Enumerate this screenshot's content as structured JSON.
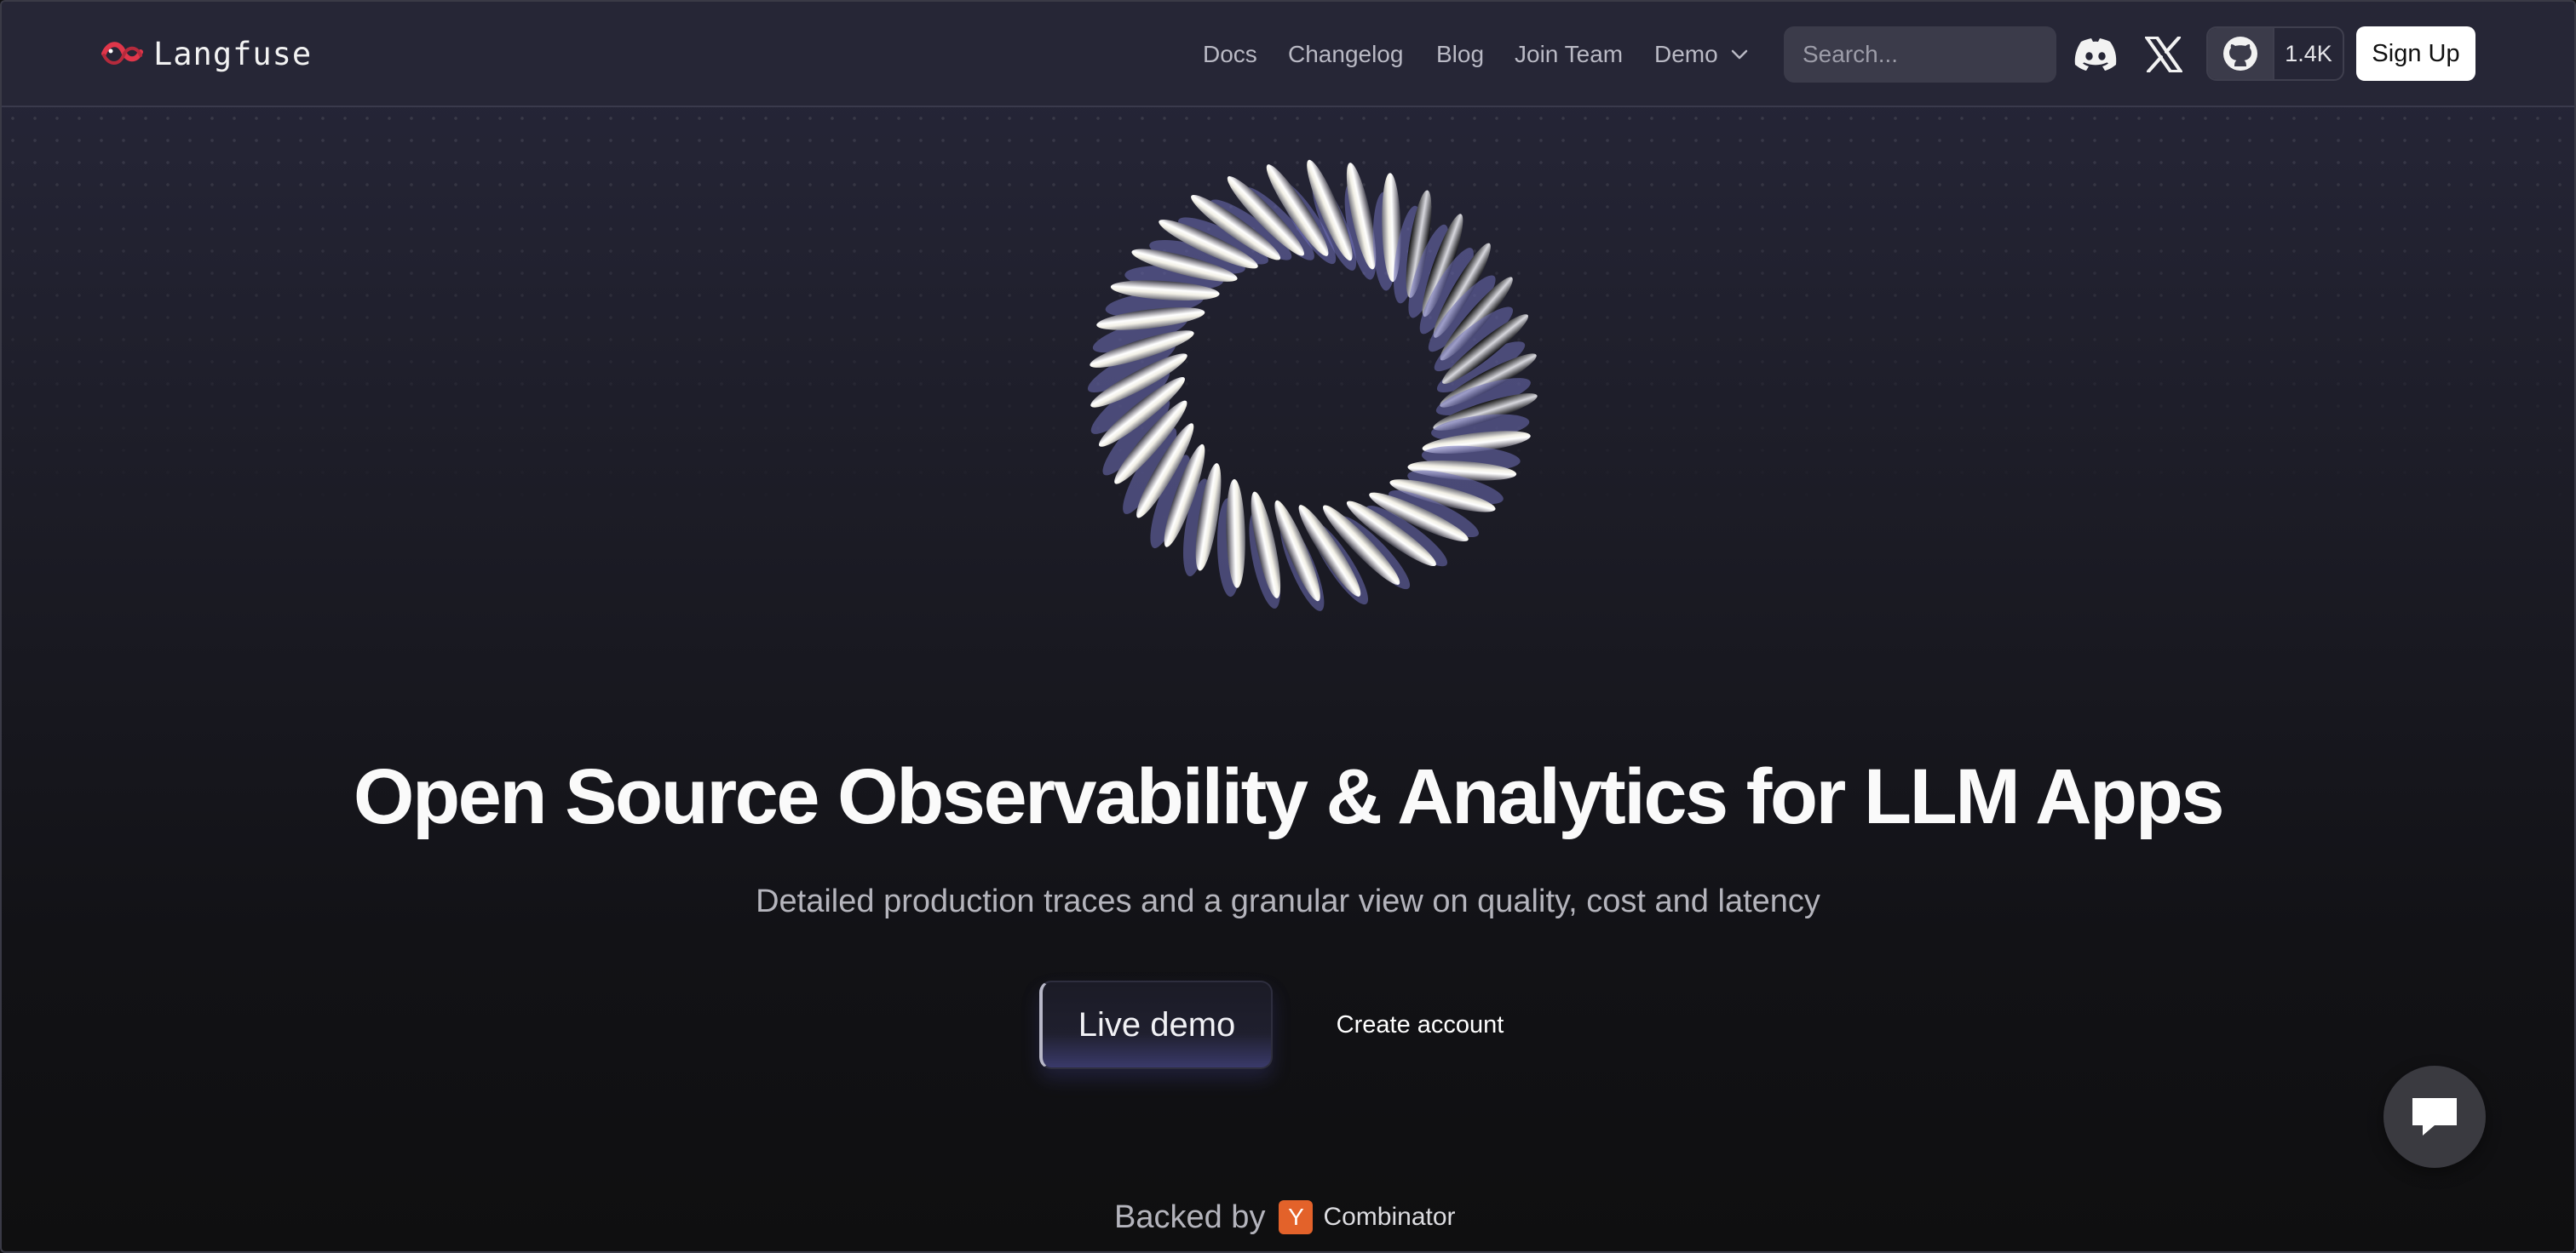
{
  "brand": {
    "name": "Langfuse",
    "accent": "#e0364a"
  },
  "nav": {
    "links": [
      "Docs",
      "Changelog",
      "Blog",
      "Join Team"
    ],
    "demo_label": "Demo",
    "search_placeholder": "Search...",
    "github_stars": "1.4K",
    "signup_label": "Sign Up",
    "icons": [
      "discord-icon",
      "x-icon",
      "github-icon",
      "chevron-down-icon"
    ]
  },
  "hero": {
    "headline": "Open Source Observability & Analytics for LLM Apps",
    "subheadline": "Detailed production traces and a granular view on quality, cost and latency",
    "primary_cta": "Live demo",
    "secondary_cta": "Create account"
  },
  "backed": {
    "label": "Backed by",
    "yc_letter": "Y",
    "yc_name": "Combinator",
    "yc_color": "#e3622a"
  },
  "chat": {
    "icon": "chat-bubble-icon"
  }
}
